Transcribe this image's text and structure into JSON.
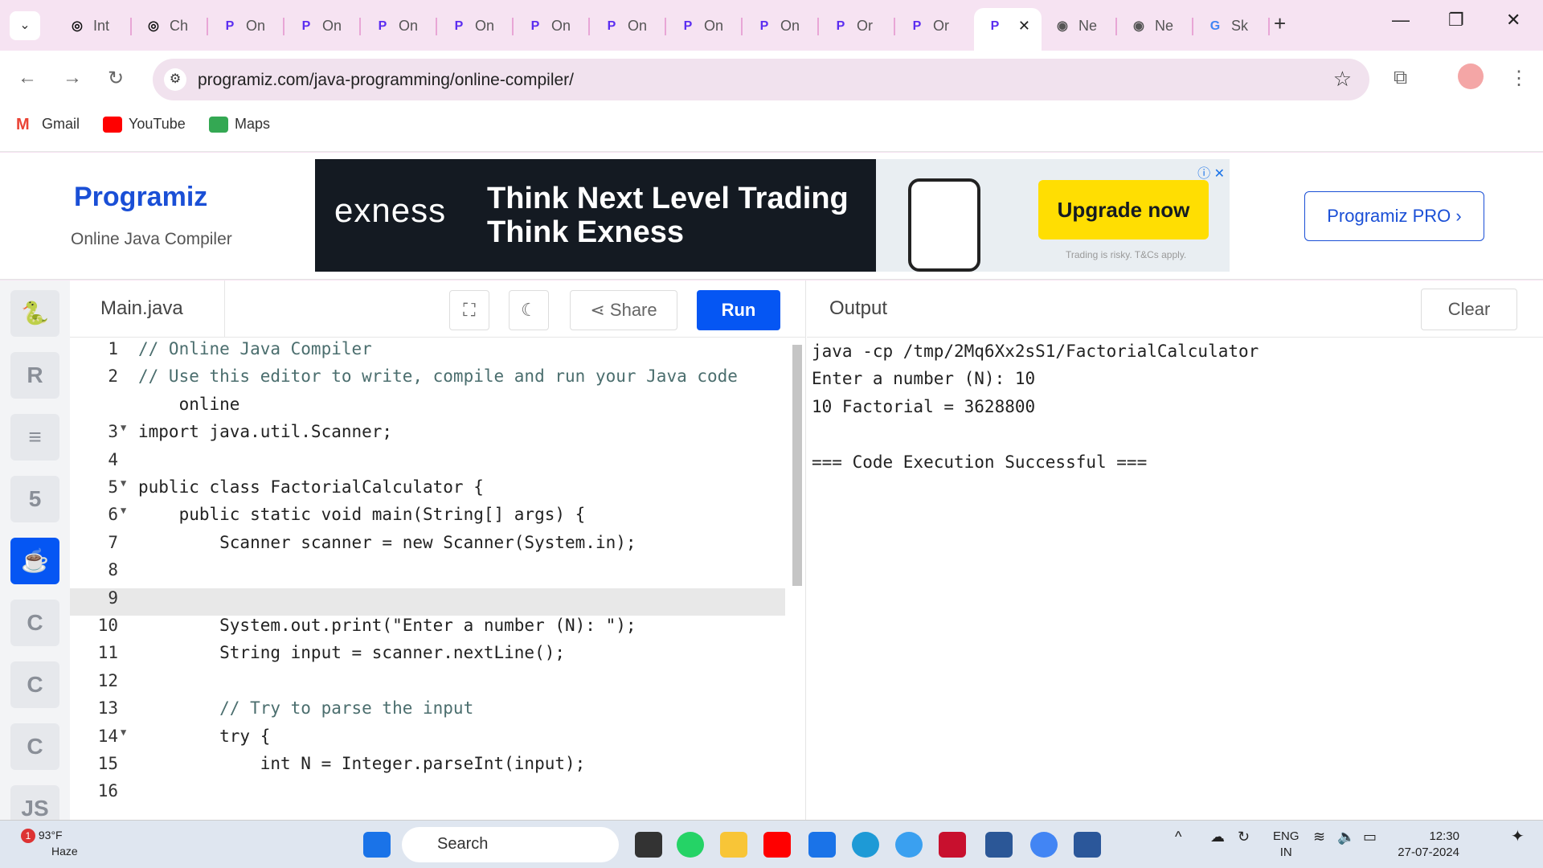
{
  "tabs": [
    {
      "label": "Int",
      "favicon": "chatgpt-icon"
    },
    {
      "label": "Ch",
      "favicon": "chatgpt-icon"
    },
    {
      "label": "On",
      "favicon": "programiz-icon"
    },
    {
      "label": "On",
      "favicon": "programiz-icon"
    },
    {
      "label": "On",
      "favicon": "programiz-icon"
    },
    {
      "label": "On",
      "favicon": "programiz-icon"
    },
    {
      "label": "On",
      "favicon": "programiz-icon"
    },
    {
      "label": "On",
      "favicon": "programiz-icon"
    },
    {
      "label": "On",
      "favicon": "programiz-icon"
    },
    {
      "label": "On",
      "favicon": "programiz-icon"
    },
    {
      "label": "Or",
      "favicon": "programiz-icon"
    },
    {
      "label": "Or",
      "favicon": "programiz-icon"
    },
    {
      "label": "",
      "favicon": "programiz-icon",
      "active": true
    },
    {
      "label": "Ne",
      "favicon": "chrome-icon"
    },
    {
      "label": "Ne",
      "favicon": "chrome-icon"
    },
    {
      "label": "Sk",
      "favicon": "google-icon"
    }
  ],
  "url": "programiz.com/java-programming/online-compiler/",
  "bookmarks": [
    "Gmail",
    "YouTube",
    "Maps"
  ],
  "site": {
    "logo": "Programiz",
    "subtitle": "Online Java Compiler",
    "pro_button": "Programiz PRO ›"
  },
  "ad": {
    "brand": "exness",
    "headline1": "Think Next Level Trading",
    "headline2": "Think Exness",
    "cta": "Upgrade now",
    "disclaimer": "Trading is risky. T&Cs apply."
  },
  "languages": [
    {
      "icon": "python-icon",
      "glyph": "🐍"
    },
    {
      "icon": "r-icon",
      "glyph": "R"
    },
    {
      "icon": "sql-icon",
      "glyph": "≡"
    },
    {
      "icon": "html-icon",
      "glyph": "5"
    },
    {
      "icon": "java-icon",
      "glyph": "☕",
      "active": true
    },
    {
      "icon": "c-icon",
      "glyph": "C"
    },
    {
      "icon": "cpp-icon",
      "glyph": "C"
    },
    {
      "icon": "csharp-icon",
      "glyph": "C"
    },
    {
      "icon": "js-icon",
      "glyph": "JS"
    }
  ],
  "editor": {
    "filename": "Main.java",
    "share": "Share",
    "run": "Run",
    "lines": [
      {
        "n": "1",
        "t": "// Online Java Compiler"
      },
      {
        "n": "2",
        "t": "// Use this editor to write, compile and run your Java code"
      },
      {
        "n": "",
        "t": "    online"
      },
      {
        "n": "3",
        "t": "import java.util.Scanner;",
        "fold": true
      },
      {
        "n": "4",
        "t": ""
      },
      {
        "n": "5",
        "t": "public class FactorialCalculator {",
        "fold": true
      },
      {
        "n": "6",
        "t": "    public static void main(String[] args) {",
        "fold": true
      },
      {
        "n": "7",
        "t": "        Scanner scanner = new Scanner(System.in);"
      },
      {
        "n": "8",
        "t": ""
      },
      {
        "n": "9",
        "t": "",
        "hl": true
      },
      {
        "n": "10",
        "t": "        System.out.print(\"Enter a number (N): \");"
      },
      {
        "n": "11",
        "t": "        String input = scanner.nextLine();"
      },
      {
        "n": "12",
        "t": ""
      },
      {
        "n": "13",
        "t": "        // Try to parse the input"
      },
      {
        "n": "14",
        "t": "        try {",
        "fold": true
      },
      {
        "n": "15",
        "t": "            int N = Integer.parseInt(input);"
      },
      {
        "n": "16",
        "t": ""
      }
    ]
  },
  "output": {
    "title": "Output",
    "clear": "Clear",
    "lines": [
      "java -cp /tmp/2Mq6Xx2sS1/FactorialCalculator",
      "Enter a number (N): 10",
      "10 Factorial = 3628800",
      "",
      "=== Code Execution Successful ==="
    ]
  },
  "taskbar": {
    "temp": "93°F",
    "weather": "Haze",
    "alert": "1",
    "search": "Search",
    "lang1": "ENG",
    "lang2": "IN",
    "time": "12:30",
    "date": "27-07-2024"
  }
}
